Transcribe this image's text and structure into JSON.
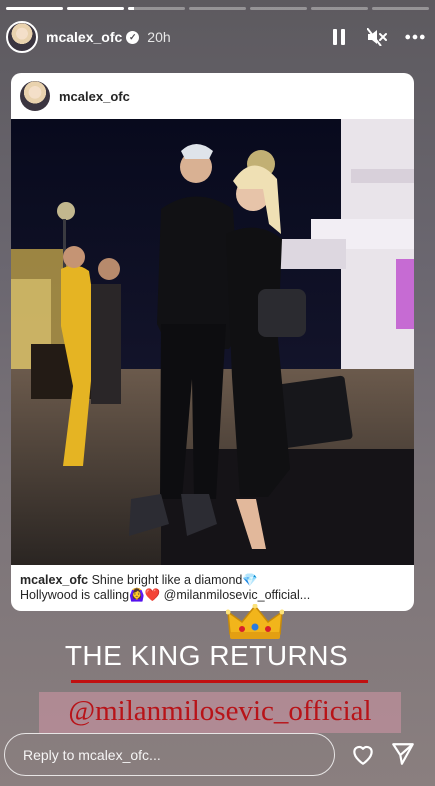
{
  "story": {
    "progress": [
      1,
      1,
      0.1,
      0,
      0,
      0,
      0
    ],
    "username": "mcalex_ofc",
    "time": "20h",
    "controls": {
      "pause": "pause-icon",
      "mute": "mute-icon",
      "more": "more-icon"
    }
  },
  "card": {
    "username": "mcalex_ofc",
    "caption_user": "mcalex_ofc",
    "caption_line1": " Shine bright like a diamond💎",
    "caption_line2": "Hollywood is calling🙆‍♀️❤️ @milanmilosevic_official..."
  },
  "overlay": {
    "headline": "THE KING RETURNS",
    "mention": "@milanmilosevic_official",
    "line_color": "#c01010",
    "mention_color": "#b81318"
  },
  "reply": {
    "placeholder": "Reply to mcalex_ofc...",
    "icons": [
      "heart-icon",
      "send-icon"
    ]
  }
}
